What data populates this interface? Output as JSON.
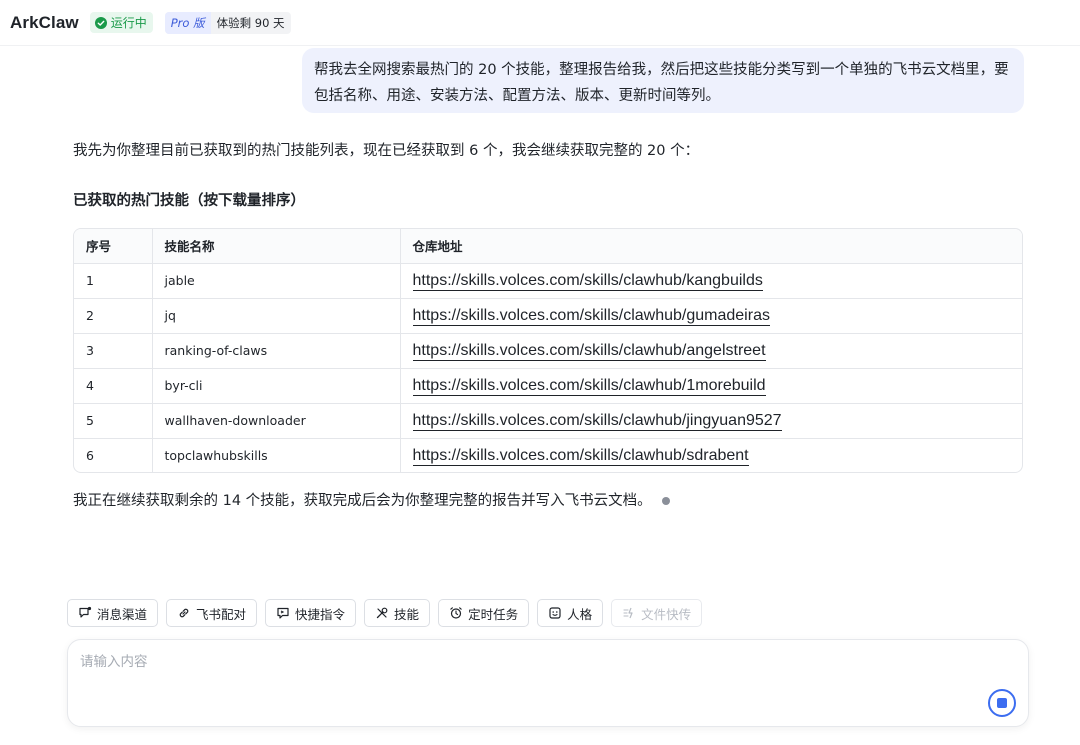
{
  "header": {
    "app_title": "ArkClaw",
    "status": "运行中",
    "plan": "Pro 版",
    "trial": "体验剩 90 天"
  },
  "chat": {
    "user_message": "帮我去全网搜索最热门的 20 个技能，整理报告给我，然后把这些技能分类写到一个单独的飞书云文档里，要包括名称、用途、安装方法、配置方法、版本、更新时间等列。",
    "intro": "我先为你整理目前已获取到的热门技能列表，现在已经获取到 6 个，我会继续获取完整的 20 个：",
    "section_title": "已获取的热门技能（按下载量排序）",
    "table": {
      "headers": [
        "序号",
        "技能名称",
        "仓库地址"
      ],
      "rows": [
        [
          "1",
          "jable",
          "https://skills.volces.com/skills/clawhub/kangbuilds"
        ],
        [
          "2",
          "jq",
          "https://skills.volces.com/skills/clawhub/gumadeiras"
        ],
        [
          "3",
          "ranking-of-claws",
          "https://skills.volces.com/skills/clawhub/angelstreet"
        ],
        [
          "4",
          "byr-cli",
          "https://skills.volces.com/skills/clawhub/1morebuild"
        ],
        [
          "5",
          "wallhaven-downloader",
          "https://skills.volces.com/skills/clawhub/jingyuan9527"
        ],
        [
          "6",
          "topclawhubskills",
          "https://skills.volces.com/skills/clawhub/sdrabent"
        ]
      ]
    },
    "progress": "我正在继续获取剩余的 14 个技能，获取完成后会为你整理完整的报告并写入飞书云文档。"
  },
  "toolbar": {
    "chips": [
      {
        "label": "消息渠道",
        "icon": "message-channel-icon"
      },
      {
        "label": "飞书配对",
        "icon": "link-icon"
      },
      {
        "label": "快捷指令",
        "icon": "shortcut-icon"
      },
      {
        "label": "技能",
        "icon": "tools-icon"
      },
      {
        "label": "定时任务",
        "icon": "alarm-clock-icon"
      },
      {
        "label": "人格",
        "icon": "persona-icon"
      },
      {
        "label": "文件快传",
        "icon": "file-transfer-icon"
      }
    ]
  },
  "input": {
    "placeholder": "请输入内容"
  },
  "colors": {
    "accent": "#3c6df0",
    "status_green": "#1a9a4a",
    "bubble": "#eef1fd"
  }
}
